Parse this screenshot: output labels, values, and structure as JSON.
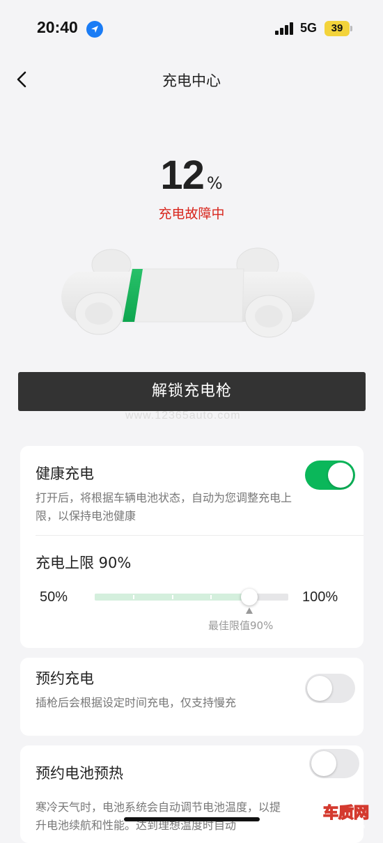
{
  "status_bar": {
    "time": "20:40",
    "network": "5G",
    "battery": "39",
    "battery_color": "#f3d33b"
  },
  "header": {
    "title": "充电中心",
    "back_icon": "chevron-left-icon"
  },
  "charge": {
    "percent": "12",
    "percent_unit": "%",
    "status": "充电故障中",
    "status_color": "#d8261d",
    "battery_level": 0.12
  },
  "unlock_button": "解锁充电枪",
  "watermark": "www.12365auto.com",
  "healthy_charging": {
    "title": "健康充电",
    "description": "打开后，将根据车辆电池状态，自动为您调整充电上限，以保持电池健康",
    "enabled": true,
    "accent_color": "#0bb75a"
  },
  "charge_limit": {
    "label": "充电上限 90%",
    "value": 90,
    "min_label": "50%",
    "max_label": "100%",
    "min": 50,
    "max": 100,
    "best_label": "最佳限值90%",
    "best_value": 90
  },
  "scheduled_charging": {
    "title": "预约充电",
    "description": "插枪后会根据设定时间充电，仅支持慢充",
    "enabled": false
  },
  "battery_preheat": {
    "title": "预约电池预热",
    "description": "寒冷天气时，电池系统会自动调节电池温度，以提升电池续航和性能。达到理想温度时自动",
    "enabled": false
  },
  "site_logo": "车质网",
  "site_logo_url_text": "12365auto.com"
}
